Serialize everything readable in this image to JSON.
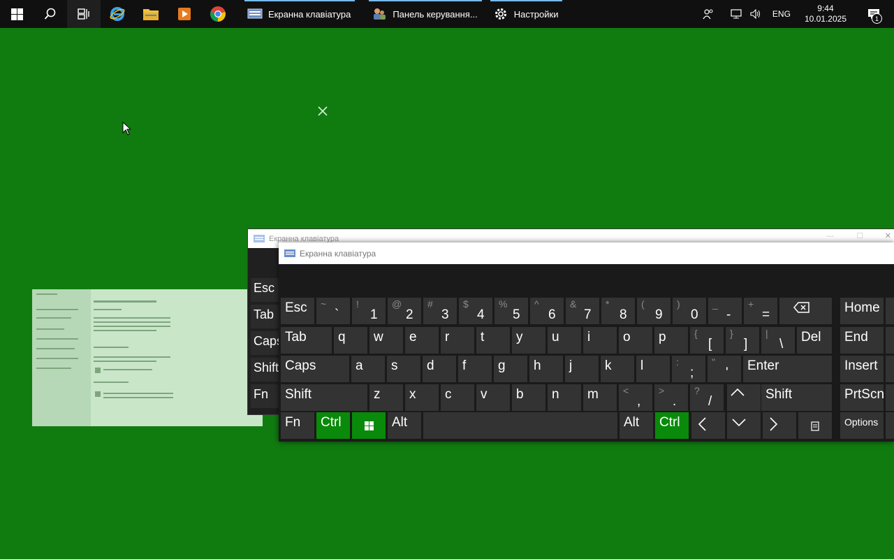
{
  "taskbar": {
    "apps": [
      {
        "label": "Екранна клавіатура",
        "icon": "keyboard-icon"
      },
      {
        "label": "Панель керування...",
        "icon": "control-panel-icon"
      },
      {
        "label": "Настройки",
        "icon": "gear-icon"
      }
    ],
    "tray": {
      "language": "ENG",
      "time": "9:44",
      "date": "10.01.2025",
      "notifications_count": "1"
    }
  },
  "back_window": {
    "title": "Екранна клавіатура",
    "side_keys": [
      "Esc",
      "Tab",
      "Caps",
      "Shift",
      "Fn"
    ]
  },
  "window": {
    "title": "Екранна клавіатура",
    "colors": {
      "accent": "#0a8a0a",
      "key": "#333333",
      "background": "#107c10"
    },
    "row1": [
      {
        "label": "Esc"
      },
      {
        "shift": "~",
        "main": "`"
      },
      {
        "shift": "!",
        "main": "1"
      },
      {
        "shift": "@",
        "main": "2"
      },
      {
        "shift": "#",
        "main": "3"
      },
      {
        "shift": "$",
        "main": "4"
      },
      {
        "shift": "%",
        "main": "5"
      },
      {
        "shift": "^",
        "main": "6"
      },
      {
        "shift": "&",
        "main": "7"
      },
      {
        "shift": "*",
        "main": "8"
      },
      {
        "shift": "(",
        "main": "9"
      },
      {
        "shift": ")",
        "main": "0"
      },
      {
        "shift": "_",
        "main": "-"
      },
      {
        "shift": "+",
        "main": "="
      }
    ],
    "row2": [
      {
        "label": "Tab"
      },
      {
        "label": "q"
      },
      {
        "label": "w"
      },
      {
        "label": "e"
      },
      {
        "label": "r"
      },
      {
        "label": "t"
      },
      {
        "label": "y"
      },
      {
        "label": "u"
      },
      {
        "label": "i"
      },
      {
        "label": "o"
      },
      {
        "label": "p"
      },
      {
        "shift": "{",
        "main": "["
      },
      {
        "shift": "}",
        "main": "]"
      },
      {
        "shift": "|",
        "main": "\\"
      },
      {
        "label": "Del"
      }
    ],
    "row3": [
      {
        "label": "Caps"
      },
      {
        "label": "a"
      },
      {
        "label": "s"
      },
      {
        "label": "d"
      },
      {
        "label": "f"
      },
      {
        "label": "g"
      },
      {
        "label": "h"
      },
      {
        "label": "j"
      },
      {
        "label": "k"
      },
      {
        "label": "l"
      },
      {
        "shift": ":",
        "main": ";"
      },
      {
        "shift": "\"",
        "main": "'"
      },
      {
        "label": "Enter"
      }
    ],
    "row4": [
      {
        "label": "Shift"
      },
      {
        "label": "z"
      },
      {
        "label": "x"
      },
      {
        "label": "c"
      },
      {
        "label": "v"
      },
      {
        "label": "b"
      },
      {
        "label": "n"
      },
      {
        "label": "m"
      },
      {
        "shift": "<",
        "main": ","
      },
      {
        "shift": ">",
        "main": "."
      },
      {
        "shift": "?",
        "main": "/"
      },
      {
        "label": "Shift"
      }
    ],
    "row5": [
      {
        "label": "Fn"
      },
      {
        "label": "Ctrl"
      },
      {
        "label": "Alt"
      },
      {
        "label": "Alt"
      },
      {
        "label": "Ctrl"
      }
    ],
    "nav": [
      {
        "label": "Home"
      },
      {
        "label": "End"
      },
      {
        "label": "Insert"
      },
      {
        "label": "PrtScn"
      },
      {
        "label": "Options"
      }
    ]
  }
}
